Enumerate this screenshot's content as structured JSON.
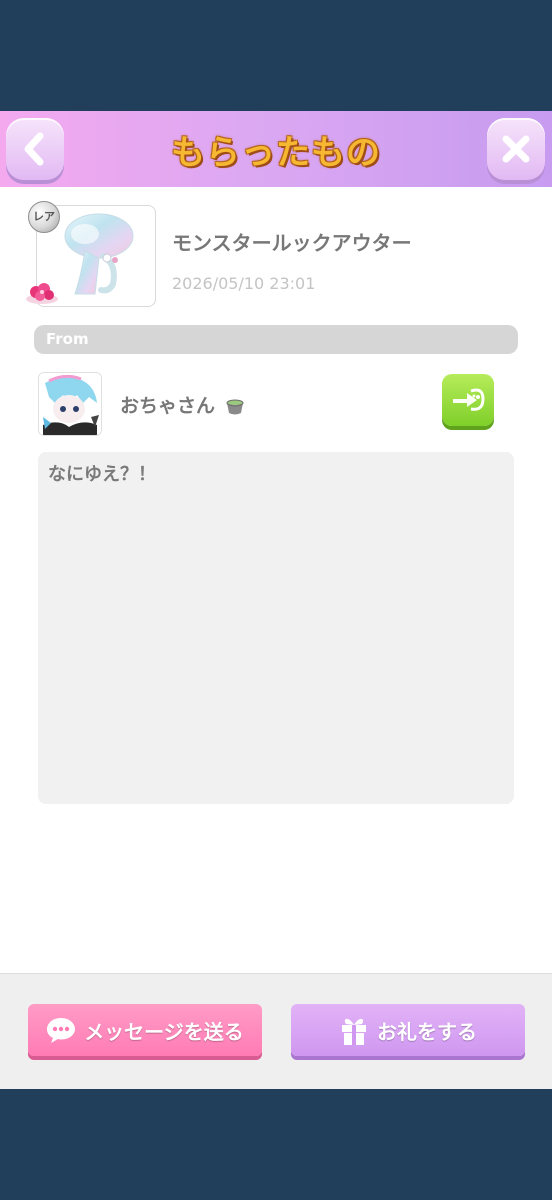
{
  "header": {
    "title": "もらったもの",
    "back_icon": "chevron-left-icon",
    "close_icon": "close-icon"
  },
  "item": {
    "rarity_badge": "レア",
    "name": "モンスタールックアウター",
    "date": "2026/05/10 23:01"
  },
  "from": {
    "label": "From",
    "sender_name": "おちゃさん"
  },
  "message": {
    "text": "なにゆえ？！"
  },
  "footer": {
    "send_message_label": "メッセージを送る",
    "thanks_label": "お礼をする"
  },
  "colors": {
    "header_gradient_start": "#f4a9ef",
    "header_gradient_end": "#c79bf0",
    "title": "#f6b731",
    "send_message_button": "#ff7bb4",
    "thanks_button": "#cf97f0",
    "profile_button": "#7fcf2a"
  }
}
